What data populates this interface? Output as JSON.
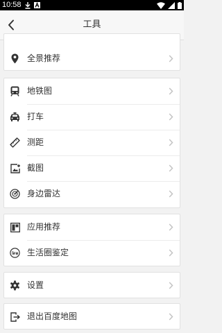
{
  "status_bar": {
    "time": "10:58"
  },
  "header": {
    "title": "工具"
  },
  "groups": [
    {
      "items": [
        {
          "label": "全景推荐",
          "icon": "location-pin-icon"
        }
      ]
    },
    {
      "items": [
        {
          "label": "地铁图",
          "icon": "subway-icon"
        },
        {
          "label": "打车",
          "icon": "taxi-icon"
        },
        {
          "label": "测距",
          "icon": "ruler-icon"
        },
        {
          "label": "截图",
          "icon": "screenshot-icon"
        },
        {
          "label": "身边雷达",
          "icon": "radar-icon"
        }
      ]
    },
    {
      "items": [
        {
          "label": "应用推荐",
          "icon": "app-grid-icon"
        },
        {
          "label": "生活圈鉴定",
          "icon": "life-circle-icon"
        }
      ]
    },
    {
      "items": [
        {
          "label": "设置",
          "icon": "gear-icon"
        }
      ]
    },
    {
      "items": [
        {
          "label": "退出百度地图",
          "icon": "exit-icon"
        }
      ]
    }
  ],
  "colors": {
    "icon": "#333333",
    "chevron": "#c4c4c4",
    "background": "#f2f2f2"
  }
}
